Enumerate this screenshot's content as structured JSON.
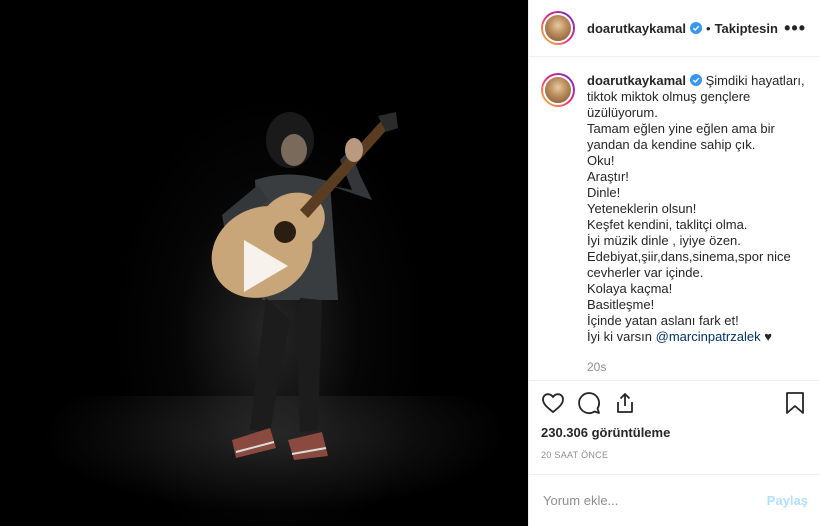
{
  "header": {
    "username": "doarutkaykamal",
    "separator": "•",
    "follow_status": "Takiptesin",
    "more": "•••"
  },
  "caption": {
    "username": "doarutkaykamal",
    "lines": [
      "Şimdiki hayatları, tiktok miktok olmuş gençlere üzülüyorum.",
      "Tamam eğlen yine eğlen ama bir yandan da kendine sahip çık.",
      "Oku!",
      "Araştır!",
      "Dinle!",
      "Yeteneklerin olsun!",
      "Keşfet kendini, taklitçi olma.",
      "İyi müzik dinle , iyiye özen.",
      "Edebiyat,şiir,dans,sinema,spor nice cevherler var içinde.",
      "Kolaya kaçma!",
      "Basitleşme!",
      "İçinde yatan aslanı fark et!"
    ],
    "last_line_prefix": "İyi ki varsın",
    "mention": "@marcinpatrzalek",
    "heart": "♥",
    "time": "20s"
  },
  "actions": {
    "views": "230.306 görüntüleme",
    "ago": "20 SAAT ÖNCE"
  },
  "comment_box": {
    "placeholder": "Yorum ekle...",
    "post_label": "Paylaş"
  },
  "colors": {
    "verified": "#3897f0",
    "mention": "#003569",
    "post_disabled": "#b2dffc"
  },
  "icons": [
    "play-icon",
    "verified-icon",
    "more-icon",
    "heart-icon",
    "comment-icon",
    "share-icon",
    "bookmark-icon"
  ]
}
